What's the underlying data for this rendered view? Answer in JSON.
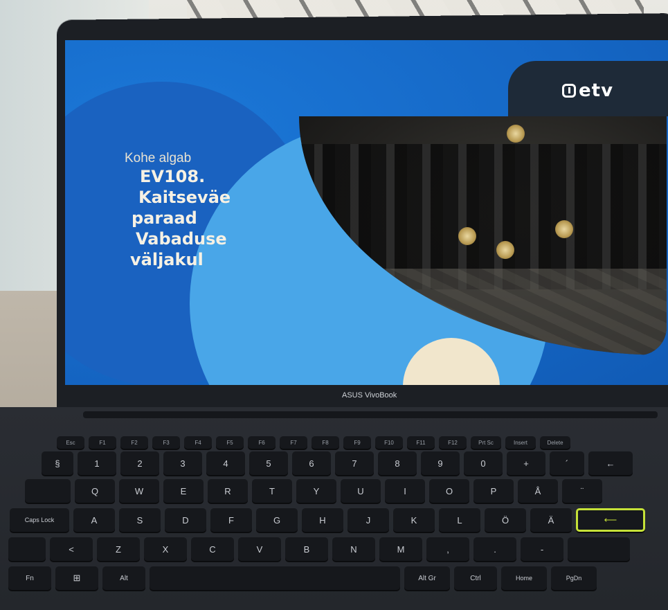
{
  "broadcast": {
    "kicker": "Kohe algab",
    "title_lines": [
      "EV108.",
      "Kaitseväe",
      "paraad",
      "Vabaduse",
      "väljakul"
    ],
    "channel_logo": "etv"
  },
  "laptop": {
    "brand_label": "ASUS VivoBook",
    "enter_key_accent": "#c6e238"
  },
  "keyboard": {
    "fn_row": [
      "Esc",
      "F1",
      "F2",
      "F3",
      "F4",
      "F5",
      "F6",
      "F7",
      "F8",
      "F9",
      "F10",
      "F11",
      "F12",
      "Prt Sc",
      "Insert",
      "Delete"
    ],
    "row1": [
      "§",
      "1",
      "2",
      "3",
      "4",
      "5",
      "6",
      "7",
      "8",
      "9",
      "0",
      "+",
      "´",
      "←"
    ],
    "row2": [
      "Q",
      "W",
      "E",
      "R",
      "T",
      "Y",
      "U",
      "I",
      "O",
      "P",
      "Å",
      "¨"
    ],
    "row3": [
      "Caps Lock",
      "A",
      "S",
      "D",
      "F",
      "G",
      "H",
      "J",
      "K",
      "L",
      "Ö",
      "Ä"
    ],
    "row4": [
      "<",
      "Z",
      "X",
      "C",
      "V",
      "B",
      "N",
      "M",
      ",",
      ".",
      "-"
    ],
    "row5": [
      "Fn",
      "⊞",
      "Alt",
      "",
      "Alt Gr",
      "Ctrl",
      "Home",
      "PgDn"
    ]
  },
  "colors": {
    "screen_blue": "#1569c8",
    "light_blue": "#49a6e8",
    "cream": "#f1e6cc",
    "logo_tab": "#1e2a38"
  }
}
